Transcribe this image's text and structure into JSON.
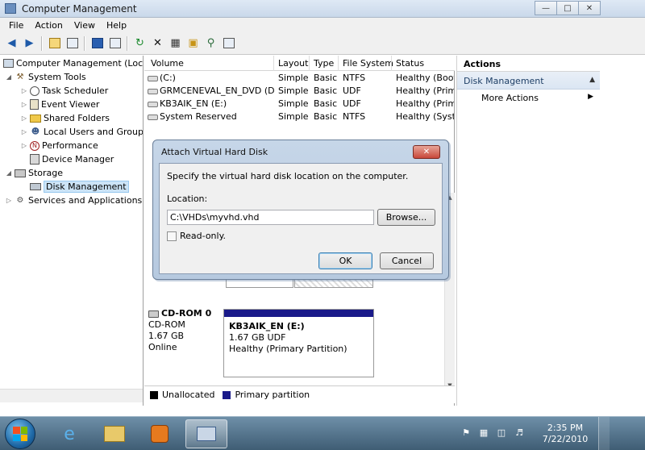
{
  "window": {
    "title": "Computer Management",
    "controls": {
      "minimize": "—",
      "maximize": "□",
      "close": "✕"
    }
  },
  "menu": [
    "File",
    "Action",
    "View",
    "Help"
  ],
  "tree": {
    "root": "Computer Management (Local",
    "system_tools": "System Tools",
    "task_scheduler": "Task Scheduler",
    "event_viewer": "Event Viewer",
    "shared_folders": "Shared Folders",
    "local_users": "Local Users and Groups",
    "performance": "Performance",
    "device_manager": "Device Manager",
    "storage": "Storage",
    "disk_management": "Disk Management",
    "services": "Services and Applications"
  },
  "volumes": {
    "headers": [
      "Volume",
      "Layout",
      "Type",
      "File System",
      "Status"
    ],
    "rows": [
      {
        "volume": "(C:)",
        "layout": "Simple",
        "type": "Basic",
        "fs": "NTFS",
        "status": "Healthy (Boot,"
      },
      {
        "volume": "GRMCENEVAL_EN_DVD (D:)",
        "layout": "Simple",
        "type": "Basic",
        "fs": "UDF",
        "status": "Healthy (Prima"
      },
      {
        "volume": "KB3AIK_EN (E:)",
        "layout": "Simple",
        "type": "Basic",
        "fs": "UDF",
        "status": "Healthy (Prima"
      },
      {
        "volume": "System Reserved",
        "layout": "Simple",
        "type": "Basic",
        "fs": "NTFS",
        "status": "Healthy (Syste"
      }
    ]
  },
  "disk": {
    "stub_text": "Healthy (Syst",
    "name": "CD-ROM 0",
    "kind": "CD-ROM",
    "size": "1.67 GB",
    "state": "Online",
    "partition_name": "KB3AIK_EN  (E:)",
    "partition_size": "1.67 GB UDF",
    "partition_status": "Healthy (Primary Partition)"
  },
  "legend": {
    "unallocated": "Unallocated",
    "primary": "Primary partition",
    "unallocated_color": "#000000",
    "primary_color": "#1a1a8a"
  },
  "actions": {
    "header": "Actions",
    "section": "Disk Management",
    "more": "More Actions"
  },
  "dialog": {
    "title": "Attach Virtual Hard Disk",
    "instruction": "Specify the virtual hard disk location on the computer.",
    "location_label": "Location:",
    "location_value": "C:\\VHDs\\myvhd.vhd",
    "browse": "Browse...",
    "readonly": "Read-only.",
    "ok": "OK",
    "cancel": "Cancel"
  },
  "taskbar": {
    "time": "2:35 PM",
    "date": "7/22/2010"
  }
}
